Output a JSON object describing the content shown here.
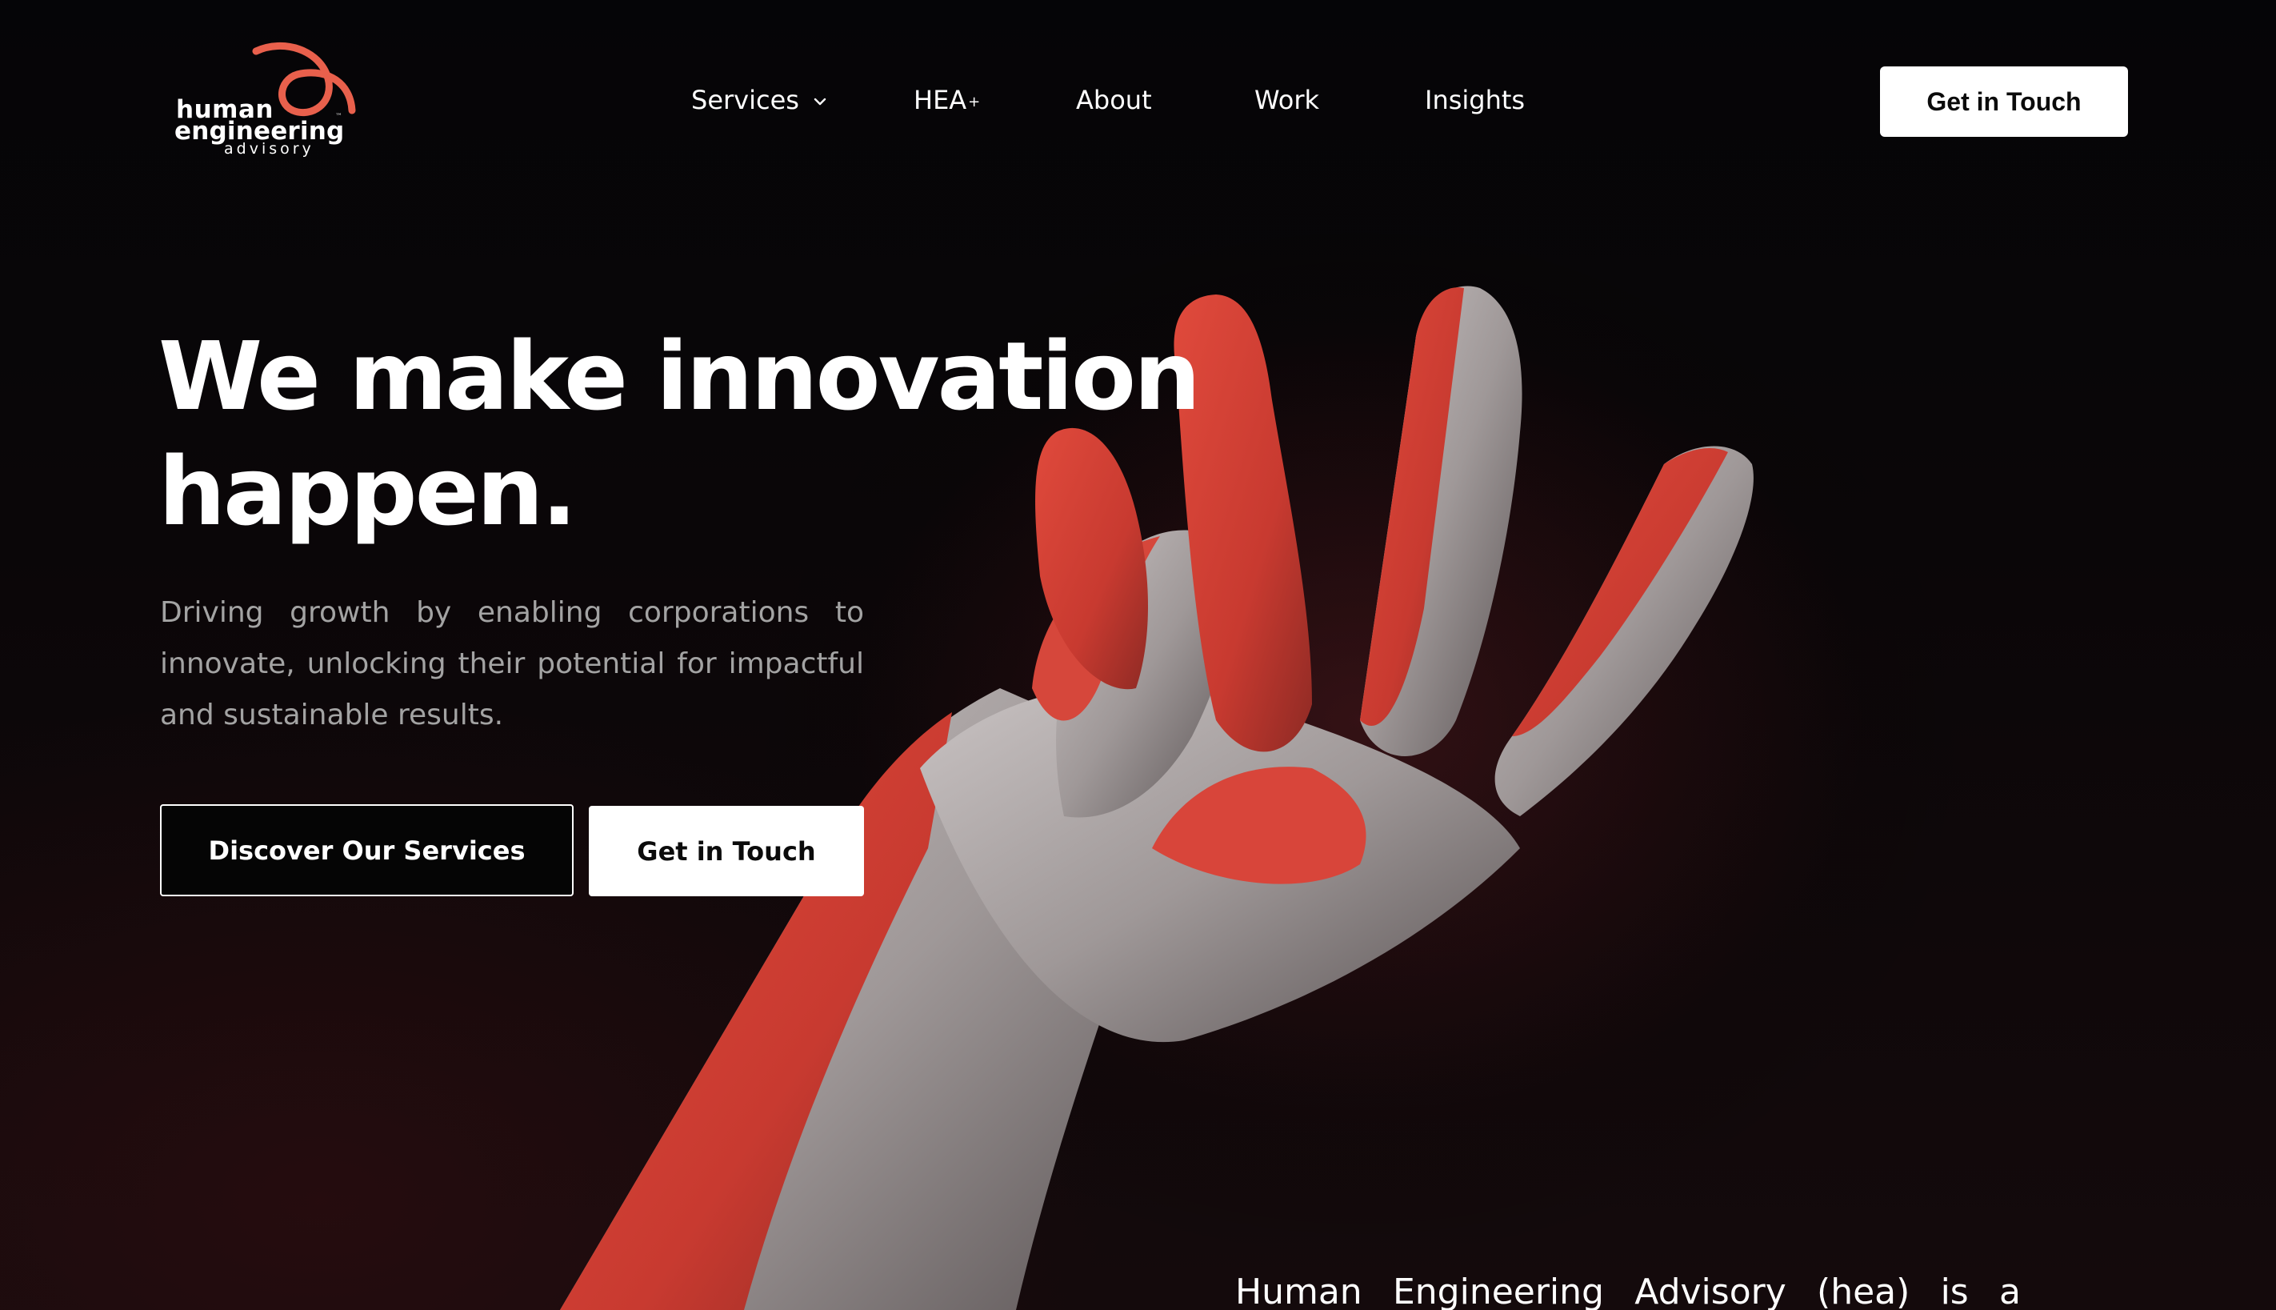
{
  "logo": {
    "line1": "human",
    "line2": "engineering",
    "line3": "advisory",
    "trademark": "™",
    "swirl_color": "#e8604c"
  },
  "nav": {
    "items": [
      {
        "label": "Services",
        "has_dropdown": true,
        "icon": "chevron-down-icon"
      },
      {
        "label": "HEA",
        "suffix": "+"
      },
      {
        "label": "About"
      },
      {
        "label": "Work"
      },
      {
        "label": "Insights"
      }
    ],
    "cta_label": "Get in Touch"
  },
  "hero": {
    "title_line1": "We make innovation",
    "title_line2": "happen.",
    "subtitle": "Driving growth by enabling corporations to innovate, unlocking their potential for impactful and sustainable results.",
    "primary_button": "Discover Our Services",
    "secondary_button": "Get in Touch"
  },
  "intro": {
    "text": "Human Engineering Advisory (hea) is a"
  },
  "colors": {
    "background": "#050507",
    "accent_red": "#e0473c",
    "text_muted": "#a3a3a3",
    "button_light": "#ffffff"
  }
}
